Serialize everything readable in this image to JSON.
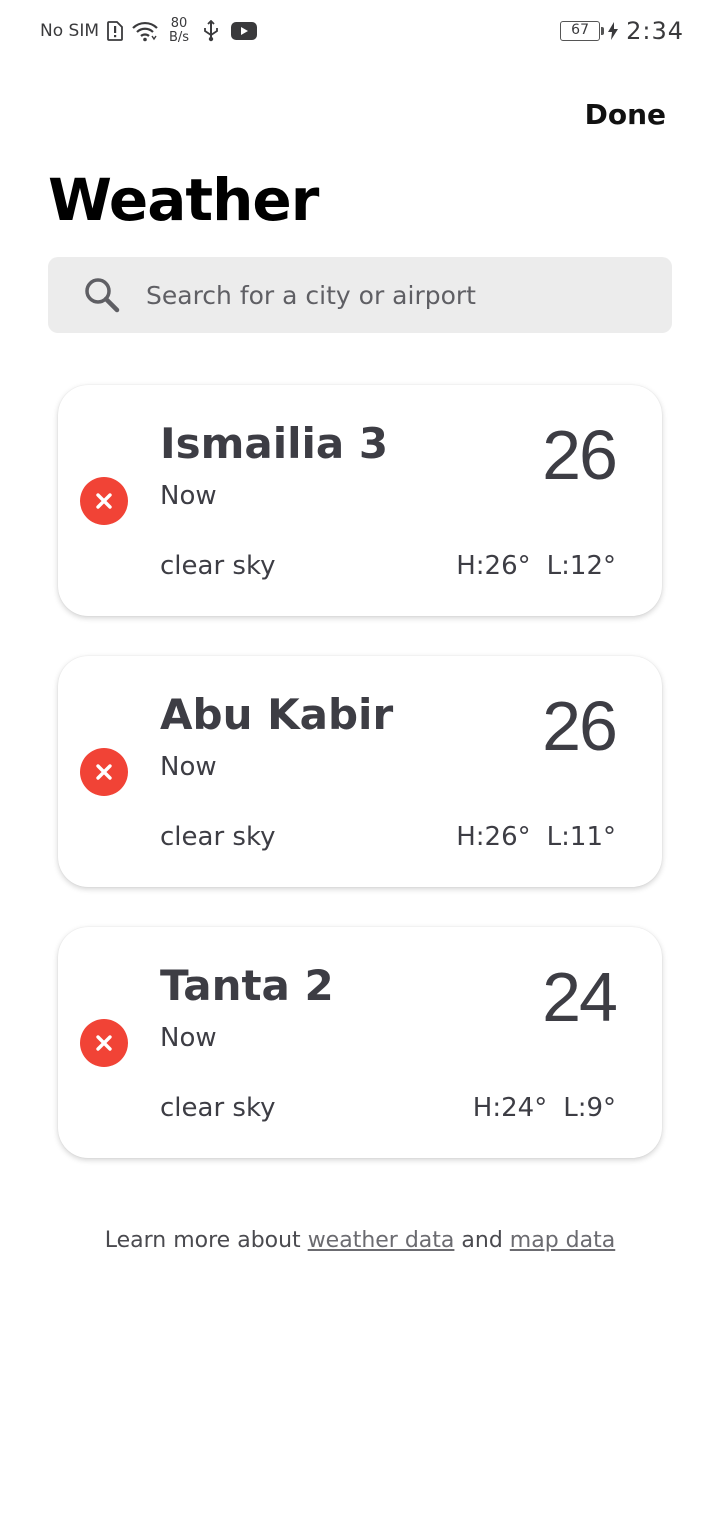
{
  "status_bar": {
    "carrier": "No SIM",
    "net_speed_value": "80",
    "net_speed_unit": "B/s",
    "battery": "67",
    "time": "2:34",
    "icons": [
      "sim-alert-icon",
      "wifi-icon",
      "usb-icon",
      "youtube-icon",
      "charging-icon"
    ]
  },
  "header": {
    "done_label": "Done",
    "title": "Weather"
  },
  "search": {
    "placeholder": "Search for a city or airport",
    "value": ""
  },
  "cities": [
    {
      "name": "Ismailia 3",
      "time": "Now",
      "temperature": "26",
      "condition": "clear sky",
      "high": "H:26°",
      "low": "L:12°"
    },
    {
      "name": "Abu Kabir",
      "time": "Now",
      "temperature": "26",
      "condition": "clear sky",
      "high": "H:26°",
      "low": "L:11°"
    },
    {
      "name": "Tanta 2",
      "time": "Now",
      "temperature": "24",
      "condition": "clear sky",
      "high": "H:24°",
      "low": "L:9°"
    }
  ],
  "footer": {
    "prefix": "Learn more about",
    "link1": "weather data",
    "middle": "and",
    "link2": "map data"
  },
  "colors": {
    "remove_button": "#f14336",
    "search_background": "#ececec",
    "text_primary": "#3d3d44"
  }
}
